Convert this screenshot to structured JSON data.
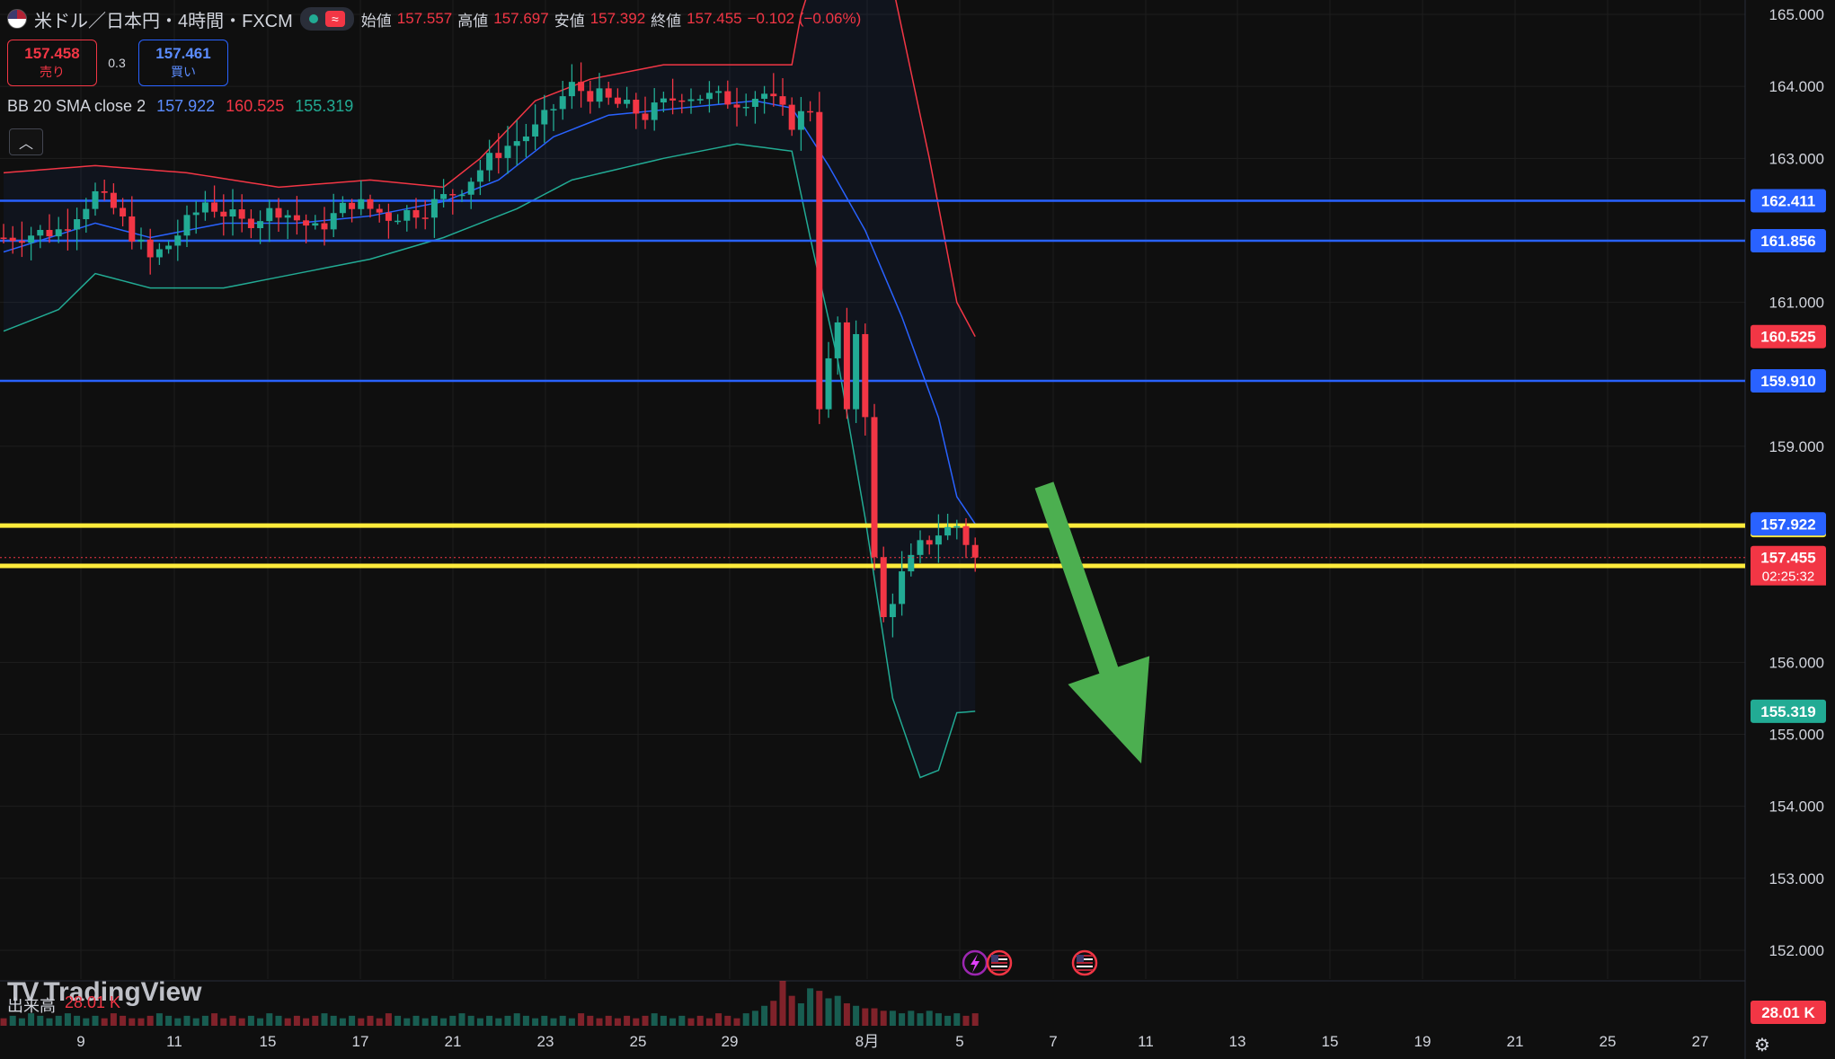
{
  "header": {
    "symbol": "米ドル／日本円・4時間・FXCM",
    "ohlc": [
      {
        "label": "始値",
        "value": "157.557"
      },
      {
        "label": "高値",
        "value": "157.697"
      },
      {
        "label": "安値",
        "value": "157.392"
      },
      {
        "label": "終値",
        "value": "157.455"
      }
    ],
    "change": "−0.102 (−0.06%)"
  },
  "trade": {
    "sell_price": "157.458",
    "sell_label": "売り",
    "spread": "0.3",
    "buy_price": "157.461",
    "buy_label": "買い"
  },
  "indicator": {
    "name": "BB 20 SMA close 2",
    "basis": "157.922",
    "upper": "160.525",
    "lower": "155.319"
  },
  "volume": {
    "label": "出来高",
    "value": "28.01 K",
    "axis_label": "28.01 K"
  },
  "watermark": "TradingView",
  "countdown": "02:25:32",
  "colors": {
    "up": "#22ab94",
    "down": "#f23645",
    "basis": "#2962ff",
    "upper": "#f23645",
    "lower": "#22ab94",
    "hline_blue": "#2962ff",
    "hline_yellow": "#ffeb3b",
    "arrow": "#4caf50",
    "bg": "#0f0f0f"
  },
  "chart_data": {
    "type": "candlestick",
    "y_axis": {
      "min": 151.6,
      "max": 165.2,
      "ticks": [
        "165.000",
        "164.000",
        "163.000",
        "161.000",
        "159.000",
        "156.000",
        "155.000",
        "154.000",
        "153.000",
        "152.000"
      ]
    },
    "x_axis": {
      "ticks": [
        "9",
        "11",
        "15",
        "17",
        "21",
        "23",
        "25",
        "29",
        "8月",
        "5",
        "7",
        "11",
        "13",
        "15",
        "19",
        "21",
        "25",
        "27"
      ]
    },
    "horizontal_lines": [
      {
        "value": 162.411,
        "label": "162.411",
        "color": "#2962ff"
      },
      {
        "value": 161.856,
        "label": "161.856",
        "color": "#2962ff"
      },
      {
        "value": 159.91,
        "label": "159.910",
        "color": "#2962ff"
      },
      {
        "value": 157.9,
        "label": "157.900",
        "color": "#ffeb3b"
      },
      {
        "value": 157.34,
        "label": "157.340",
        "color": "#ffeb3b"
      }
    ],
    "price_labels": [
      {
        "value": 160.525,
        "label": "160.525",
        "color": "#f23645"
      },
      {
        "value": 157.922,
        "label": "157.922",
        "color": "#2962ff"
      },
      {
        "value": 157.455,
        "label": "157.455",
        "color": "#f23645"
      },
      {
        "value": 155.319,
        "label": "155.319",
        "color": "#22ab94"
      }
    ],
    "keypoints": [
      [
        0,
        161.9
      ],
      [
        6,
        162.0
      ],
      [
        10,
        162.5
      ],
      [
        12,
        162.3
      ],
      [
        16,
        161.6
      ],
      [
        18,
        161.8
      ],
      [
        22,
        162.4
      ],
      [
        26,
        162.1
      ],
      [
        30,
        162.3
      ],
      [
        34,
        162.0
      ],
      [
        38,
        162.4
      ],
      [
        42,
        162.2
      ],
      [
        46,
        162.3
      ],
      [
        50,
        162.6
      ],
      [
        54,
        163.1
      ],
      [
        58,
        163.4
      ],
      [
        62,
        164.0
      ],
      [
        66,
        163.8
      ],
      [
        70,
        163.6
      ],
      [
        74,
        163.9
      ],
      [
        80,
        163.8
      ],
      [
        83,
        163.9
      ],
      [
        86,
        163.5
      ],
      [
        88,
        163.7
      ],
      [
        89,
        159.6
      ],
      [
        91,
        160.7
      ],
      [
        92,
        159.4
      ],
      [
        93,
        160.6
      ],
      [
        94,
        159.5
      ],
      [
        95,
        157.4
      ],
      [
        96,
        156.6
      ],
      [
        98,
        157.2
      ],
      [
        100,
        157.6
      ],
      [
        102,
        157.8
      ],
      [
        104,
        157.9
      ],
      [
        106,
        157.455
      ]
    ],
    "bb_upper": [
      [
        0,
        162.8
      ],
      [
        10,
        162.9
      ],
      [
        20,
        162.8
      ],
      [
        30,
        162.6
      ],
      [
        40,
        162.7
      ],
      [
        48,
        162.6
      ],
      [
        52,
        163.0
      ],
      [
        58,
        163.8
      ],
      [
        64,
        164.1
      ],
      [
        72,
        164.3
      ],
      [
        80,
        164.3
      ],
      [
        86,
        164.3
      ],
      [
        87,
        165.0
      ],
      [
        90,
        166.2
      ],
      [
        97,
        165.4
      ],
      [
        101,
        163.0
      ],
      [
        104,
        161.0
      ],
      [
        106,
        160.525
      ]
    ],
    "bb_basis": [
      [
        0,
        161.7
      ],
      [
        10,
        162.1
      ],
      [
        16,
        161.9
      ],
      [
        24,
        162.1
      ],
      [
        32,
        162.1
      ],
      [
        40,
        162.2
      ],
      [
        48,
        162.4
      ],
      [
        54,
        162.7
      ],
      [
        60,
        163.3
      ],
      [
        66,
        163.6
      ],
      [
        74,
        163.7
      ],
      [
        82,
        163.8
      ],
      [
        86,
        163.7
      ],
      [
        90,
        162.9
      ],
      [
        94,
        162.0
      ],
      [
        98,
        160.8
      ],
      [
        102,
        159.4
      ],
      [
        104,
        158.3
      ],
      [
        106,
        157.922
      ]
    ],
    "bb_lower": [
      [
        0,
        160.6
      ],
      [
        6,
        160.9
      ],
      [
        10,
        161.4
      ],
      [
        16,
        161.2
      ],
      [
        24,
        161.2
      ],
      [
        32,
        161.4
      ],
      [
        40,
        161.6
      ],
      [
        48,
        161.9
      ],
      [
        56,
        162.3
      ],
      [
        62,
        162.7
      ],
      [
        72,
        163.0
      ],
      [
        80,
        163.2
      ],
      [
        86,
        163.1
      ],
      [
        88,
        161.9
      ],
      [
        91,
        160.2
      ],
      [
        94,
        158.0
      ],
      [
        97,
        155.5
      ],
      [
        100,
        154.4
      ],
      [
        102,
        154.5
      ],
      [
        104,
        155.3
      ],
      [
        106,
        155.319
      ]
    ],
    "volume": [
      3,
      4,
      3,
      5,
      4,
      3,
      4,
      5,
      4,
      3,
      4,
      3,
      5,
      4,
      3,
      3,
      4,
      5,
      4,
      3,
      4,
      3,
      4,
      5,
      3,
      4,
      3,
      4,
      3,
      5,
      4,
      3,
      4,
      3,
      4,
      5,
      4,
      3,
      4,
      3,
      4,
      3,
      5,
      4,
      3,
      4,
      3,
      4,
      3,
      4,
      5,
      4,
      3,
      4,
      3,
      4,
      5,
      4,
      3,
      4,
      3,
      4,
      3,
      5,
      4,
      3,
      4,
      3,
      4,
      3,
      4,
      5,
      4,
      3,
      4,
      3,
      4,
      3,
      5,
      4,
      3,
      5,
      6,
      8,
      10,
      18,
      12,
      9,
      15,
      14,
      11,
      12,
      9,
      8,
      7,
      7,
      6,
      6,
      5,
      6,
      5,
      6,
      5,
      4,
      5,
      4,
      5
    ]
  },
  "arrow": {
    "direction": "down",
    "from": [
      1162,
      540
    ],
    "to": [
      1270,
      850
    ]
  },
  "events": [
    "lightning-event",
    "us-flag-event",
    "us-flag-event"
  ]
}
